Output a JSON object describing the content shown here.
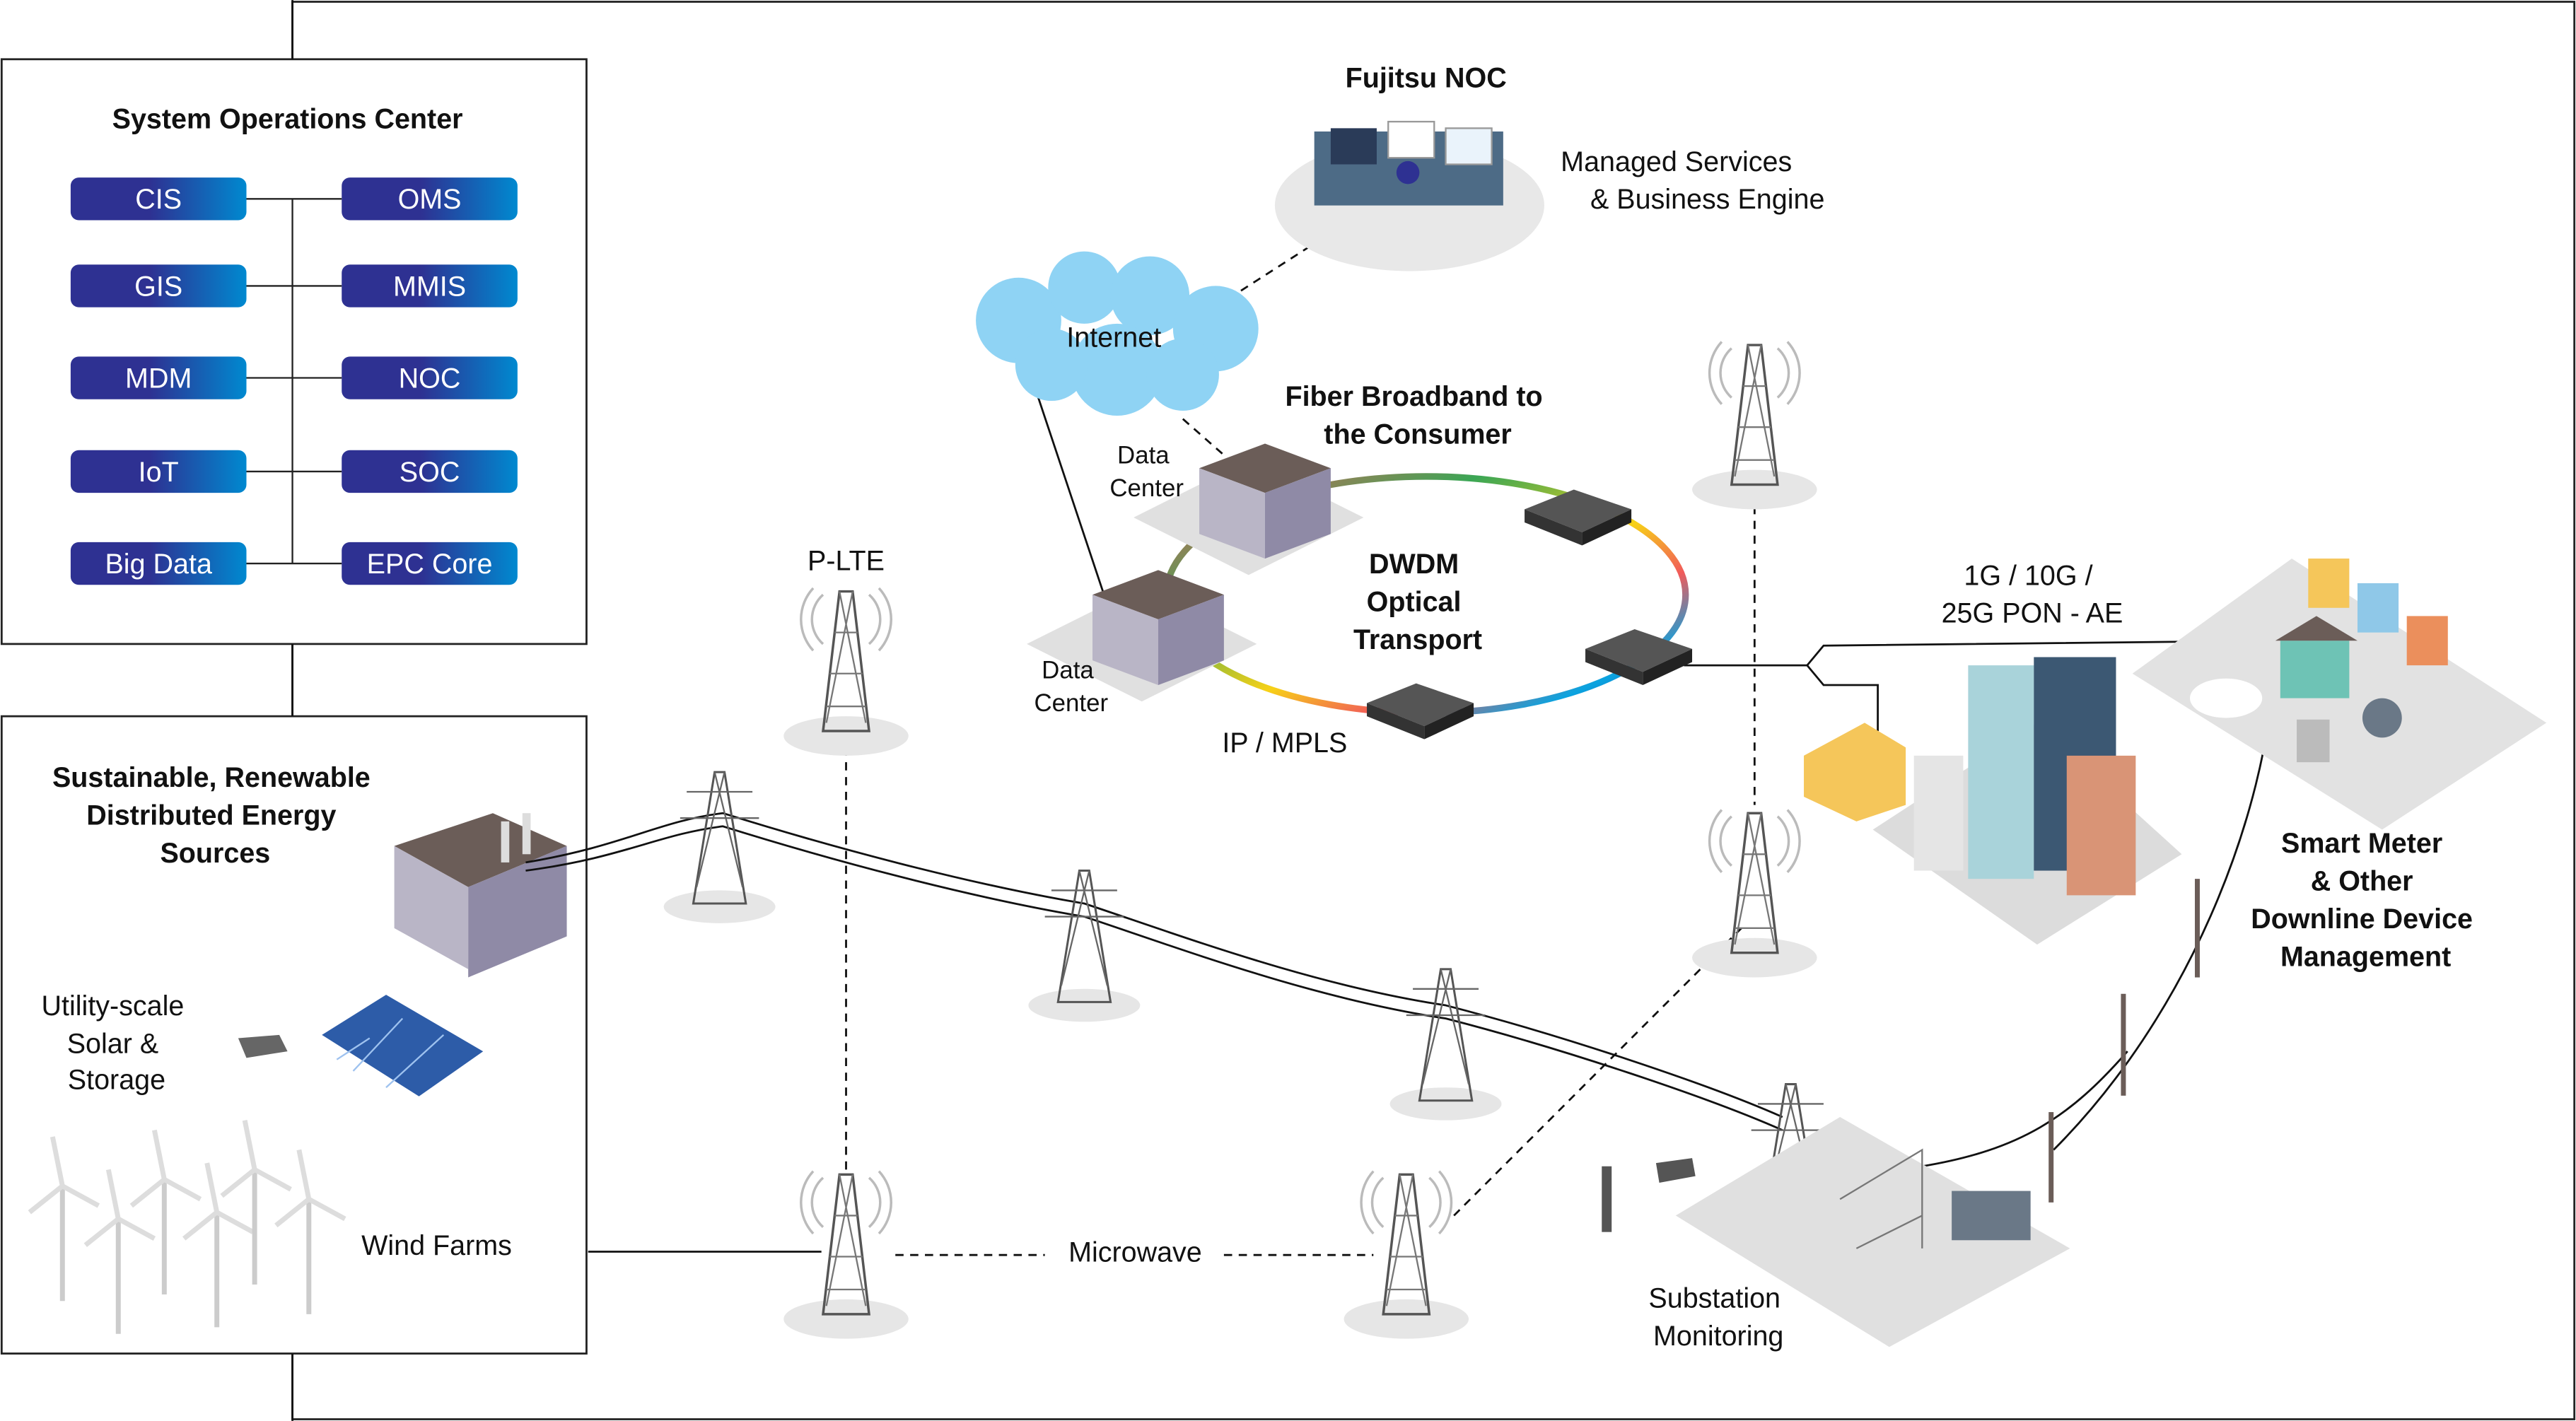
{
  "soc": {
    "title": "System Operations Center",
    "left_items": [
      "CIS",
      "GIS",
      "MDM",
      "IoT",
      "Big Data"
    ],
    "right_items": [
      "OMS",
      "MMIS",
      "NOC",
      "SOC",
      "EPC Core"
    ]
  },
  "energy": {
    "title_lines": [
      "Sustainable, Renewable",
      "Distributed Energy",
      "Sources"
    ],
    "solar_lines": [
      "Utility-scale",
      "Solar &",
      "Storage"
    ],
    "wind": "Wind Farms"
  },
  "noc": {
    "title": "Fujitsu NOC",
    "subtitle_lines": [
      "Managed Services",
      "& Business Engine"
    ]
  },
  "internet": "Internet",
  "fiber": {
    "lines": [
      "Fiber Broadband to",
      "the Consumer"
    ]
  },
  "data_center_1": [
    "Data",
    "Center"
  ],
  "data_center_2": [
    "Data",
    "Center"
  ],
  "dwdm": {
    "lines": [
      "DWDM",
      "Optical",
      "Transport"
    ]
  },
  "ip_mpls": "IP / MPLS",
  "plte": "P-LTE",
  "pon": {
    "lines": [
      "1G / 10G /",
      "25G PON - AE"
    ]
  },
  "smart_meter": {
    "lines": [
      "Smart Meter",
      "& Other",
      "Downline Device",
      "Management"
    ]
  },
  "microwave": "Microwave",
  "substation": {
    "lines": [
      "Substation",
      "Monitoring"
    ]
  },
  "colors": {
    "button_start": "#2e3192",
    "button_end": "#0089d0",
    "ring": [
      "#3aa655",
      "#f7d117",
      "#f15a5a",
      "#2e3192",
      "#0aa3e0"
    ],
    "cloud": "#8fd3f4",
    "ground": "#dcdcdc"
  }
}
